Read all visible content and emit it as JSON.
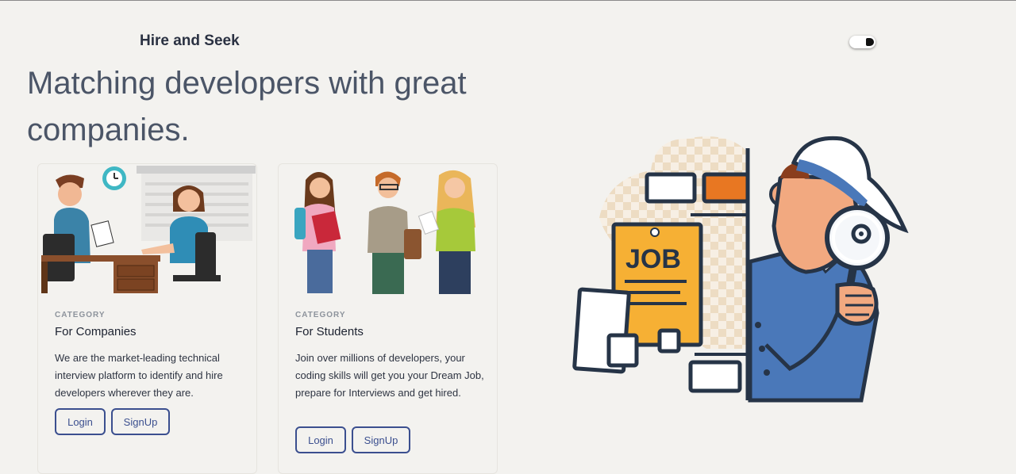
{
  "brand": {
    "name": "Hire and Seek"
  },
  "hero": {
    "heading": "Matching developers with great companies."
  },
  "theme_toggle": {
    "state": "dark-half"
  },
  "cards": [
    {
      "category": "CATEGORY",
      "title": "For Companies",
      "description": "We are the market-leading technical interview platform to identify and hire developers wherever they are.",
      "login_label": "Login",
      "signup_label": "SignUp"
    },
    {
      "category": "CATEGORY",
      "title": "For Students",
      "description": "Join over millions of developers, your coding skills will get you your Dream Job, prepare for Interviews and get hired.",
      "login_label": "Login",
      "signup_label": "SignUp"
    }
  ],
  "illustration": {
    "sign_text": "JOB"
  },
  "colors": {
    "accent": "#3b4f8f",
    "background": "#f3f2ef",
    "job_paper": "#f6b034",
    "detective_blue": "#4a78b9"
  }
}
